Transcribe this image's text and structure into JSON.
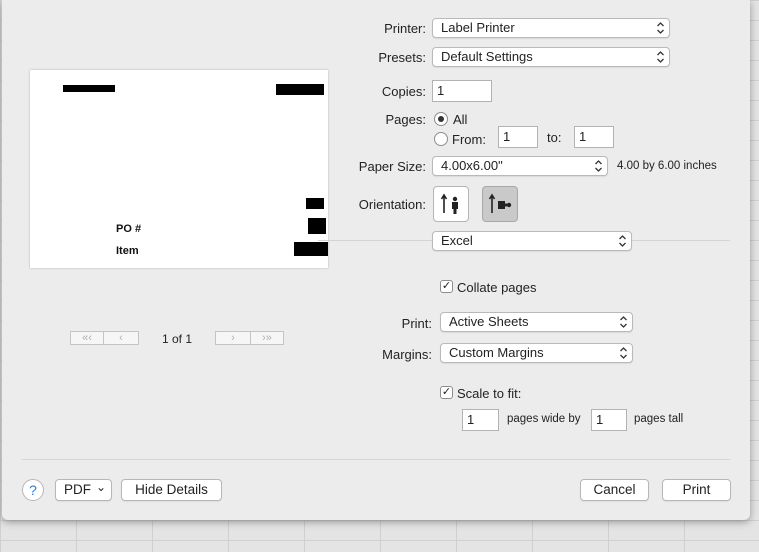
{
  "printer": {
    "label": "Printer:",
    "value": "Label Printer"
  },
  "presets": {
    "label": "Presets:",
    "value": "Default Settings"
  },
  "copies": {
    "label": "Copies:",
    "value": "1"
  },
  "pages": {
    "label": "Pages:",
    "all_label": "All",
    "from_label": "From:",
    "from_value": "1",
    "to_label": "to:",
    "to_value": "1",
    "selected": "All"
  },
  "paper_size": {
    "label": "Paper Size:",
    "value": "4.00x6.00\"",
    "description": "4.00 by 6.00 inches"
  },
  "orientation": {
    "label": "Orientation:",
    "selected": "landscape",
    "portrait_icon": "portrait-person-icon",
    "landscape_icon": "landscape-person-icon"
  },
  "section_menu": {
    "value": "Excel"
  },
  "collate": {
    "label": "Collate pages",
    "checked": true,
    "mark": "✓"
  },
  "print_what": {
    "label": "Print:",
    "value": "Active Sheets"
  },
  "margins": {
    "label": "Margins:",
    "value": "Custom Margins"
  },
  "scale": {
    "label": "Scale to fit:",
    "checked": true,
    "mark": "✓",
    "wide_value": "1",
    "wide_label": "pages wide by",
    "tall_value": "1",
    "tall_label": "pages tall"
  },
  "preview": {
    "labels": [
      "PO #",
      "Item"
    ],
    "page_indicator": "1 of 1",
    "first_glyph": "«‹",
    "prev_glyph": "‹",
    "next_glyph": "›",
    "last_glyph": "›»"
  },
  "footer": {
    "help_glyph": "?",
    "pdf_label": "PDF",
    "pdf_arrow": "⌄",
    "hide_details_label": "Hide Details",
    "cancel_label": "Cancel",
    "print_label": "Print"
  },
  "colors": {
    "help_accent": "#2e7bd6",
    "selected_orientation": "#c9c9c9"
  }
}
